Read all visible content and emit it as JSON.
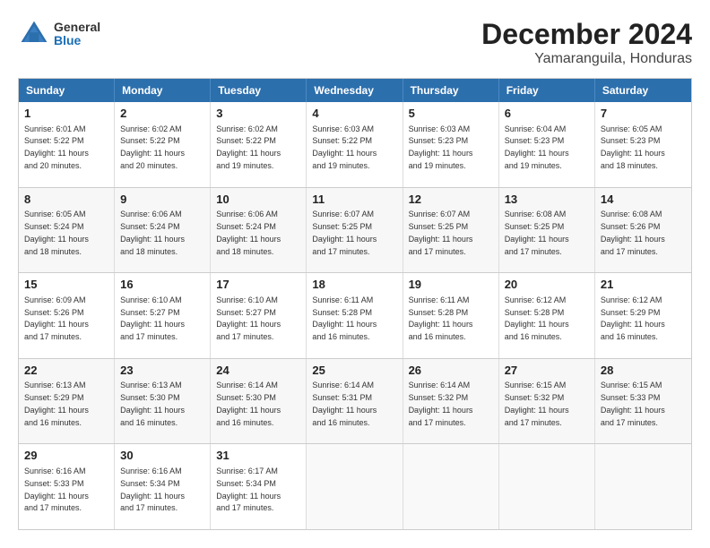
{
  "logo": {
    "line1": "General",
    "line2": "Blue"
  },
  "title": "December 2024",
  "location": "Yamaranguila, Honduras",
  "header": {
    "days": [
      "Sunday",
      "Monday",
      "Tuesday",
      "Wednesday",
      "Thursday",
      "Friday",
      "Saturday"
    ]
  },
  "weeks": [
    [
      {
        "day": "1",
        "info": "Sunrise: 6:01 AM\nSunset: 5:22 PM\nDaylight: 11 hours\nand 20 minutes."
      },
      {
        "day": "2",
        "info": "Sunrise: 6:02 AM\nSunset: 5:22 PM\nDaylight: 11 hours\nand 20 minutes."
      },
      {
        "day": "3",
        "info": "Sunrise: 6:02 AM\nSunset: 5:22 PM\nDaylight: 11 hours\nand 19 minutes."
      },
      {
        "day": "4",
        "info": "Sunrise: 6:03 AM\nSunset: 5:22 PM\nDaylight: 11 hours\nand 19 minutes."
      },
      {
        "day": "5",
        "info": "Sunrise: 6:03 AM\nSunset: 5:23 PM\nDaylight: 11 hours\nand 19 minutes."
      },
      {
        "day": "6",
        "info": "Sunrise: 6:04 AM\nSunset: 5:23 PM\nDaylight: 11 hours\nand 19 minutes."
      },
      {
        "day": "7",
        "info": "Sunrise: 6:05 AM\nSunset: 5:23 PM\nDaylight: 11 hours\nand 18 minutes."
      }
    ],
    [
      {
        "day": "8",
        "info": "Sunrise: 6:05 AM\nSunset: 5:24 PM\nDaylight: 11 hours\nand 18 minutes."
      },
      {
        "day": "9",
        "info": "Sunrise: 6:06 AM\nSunset: 5:24 PM\nDaylight: 11 hours\nand 18 minutes."
      },
      {
        "day": "10",
        "info": "Sunrise: 6:06 AM\nSunset: 5:24 PM\nDaylight: 11 hours\nand 18 minutes."
      },
      {
        "day": "11",
        "info": "Sunrise: 6:07 AM\nSunset: 5:25 PM\nDaylight: 11 hours\nand 17 minutes."
      },
      {
        "day": "12",
        "info": "Sunrise: 6:07 AM\nSunset: 5:25 PM\nDaylight: 11 hours\nand 17 minutes."
      },
      {
        "day": "13",
        "info": "Sunrise: 6:08 AM\nSunset: 5:25 PM\nDaylight: 11 hours\nand 17 minutes."
      },
      {
        "day": "14",
        "info": "Sunrise: 6:08 AM\nSunset: 5:26 PM\nDaylight: 11 hours\nand 17 minutes."
      }
    ],
    [
      {
        "day": "15",
        "info": "Sunrise: 6:09 AM\nSunset: 5:26 PM\nDaylight: 11 hours\nand 17 minutes."
      },
      {
        "day": "16",
        "info": "Sunrise: 6:10 AM\nSunset: 5:27 PM\nDaylight: 11 hours\nand 17 minutes."
      },
      {
        "day": "17",
        "info": "Sunrise: 6:10 AM\nSunset: 5:27 PM\nDaylight: 11 hours\nand 17 minutes."
      },
      {
        "day": "18",
        "info": "Sunrise: 6:11 AM\nSunset: 5:28 PM\nDaylight: 11 hours\nand 16 minutes."
      },
      {
        "day": "19",
        "info": "Sunrise: 6:11 AM\nSunset: 5:28 PM\nDaylight: 11 hours\nand 16 minutes."
      },
      {
        "day": "20",
        "info": "Sunrise: 6:12 AM\nSunset: 5:28 PM\nDaylight: 11 hours\nand 16 minutes."
      },
      {
        "day": "21",
        "info": "Sunrise: 6:12 AM\nSunset: 5:29 PM\nDaylight: 11 hours\nand 16 minutes."
      }
    ],
    [
      {
        "day": "22",
        "info": "Sunrise: 6:13 AM\nSunset: 5:29 PM\nDaylight: 11 hours\nand 16 minutes."
      },
      {
        "day": "23",
        "info": "Sunrise: 6:13 AM\nSunset: 5:30 PM\nDaylight: 11 hours\nand 16 minutes."
      },
      {
        "day": "24",
        "info": "Sunrise: 6:14 AM\nSunset: 5:30 PM\nDaylight: 11 hours\nand 16 minutes."
      },
      {
        "day": "25",
        "info": "Sunrise: 6:14 AM\nSunset: 5:31 PM\nDaylight: 11 hours\nand 16 minutes."
      },
      {
        "day": "26",
        "info": "Sunrise: 6:14 AM\nSunset: 5:32 PM\nDaylight: 11 hours\nand 17 minutes."
      },
      {
        "day": "27",
        "info": "Sunrise: 6:15 AM\nSunset: 5:32 PM\nDaylight: 11 hours\nand 17 minutes."
      },
      {
        "day": "28",
        "info": "Sunrise: 6:15 AM\nSunset: 5:33 PM\nDaylight: 11 hours\nand 17 minutes."
      }
    ],
    [
      {
        "day": "29",
        "info": "Sunrise: 6:16 AM\nSunset: 5:33 PM\nDaylight: 11 hours\nand 17 minutes."
      },
      {
        "day": "30",
        "info": "Sunrise: 6:16 AM\nSunset: 5:34 PM\nDaylight: 11 hours\nand 17 minutes."
      },
      {
        "day": "31",
        "info": "Sunrise: 6:17 AM\nSunset: 5:34 PM\nDaylight: 11 hours\nand 17 minutes."
      },
      null,
      null,
      null,
      null
    ]
  ]
}
